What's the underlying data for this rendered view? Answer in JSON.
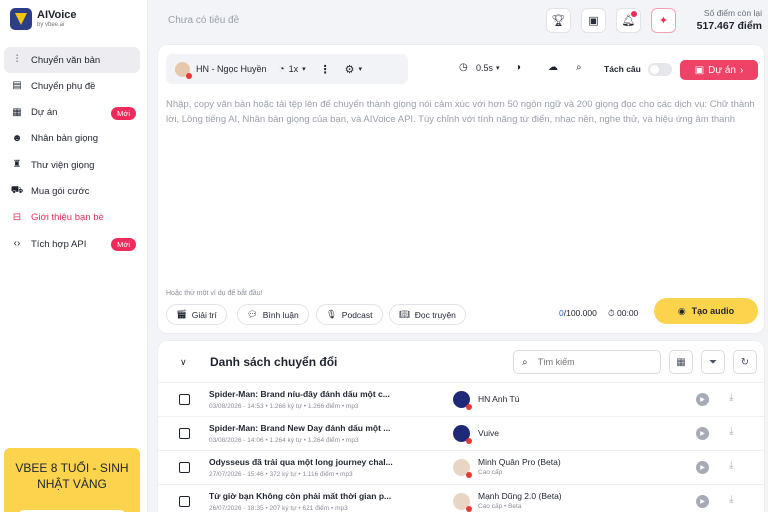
{
  "brand": {
    "name": "AIVoice",
    "by": "by vbee.ai"
  },
  "sidebar": {
    "items": [
      {
        "label": "Chuyển văn bản",
        "icon": "waveform-icon",
        "glyph": "⫶",
        "active": true,
        "new": false,
        "red": false
      },
      {
        "label": "Chuyển phụ đề",
        "icon": "subtitle-icon",
        "glyph": "▤",
        "active": false,
        "new": false,
        "red": false
      },
      {
        "label": "Dự án",
        "icon": "clapperboard-icon",
        "glyph": "▦",
        "active": false,
        "new": true,
        "red": false
      },
      {
        "label": "Nhân bản giọng",
        "icon": "voice-clone-icon",
        "glyph": "☻",
        "active": false,
        "new": false,
        "red": false
      },
      {
        "label": "Thư viện giọng",
        "icon": "voice-library-icon",
        "glyph": "♜",
        "active": false,
        "new": false,
        "red": false
      },
      {
        "label": "Mua gói cước",
        "icon": "cart-icon",
        "glyph": "⛟",
        "active": false,
        "new": false,
        "red": false
      },
      {
        "label": "Giới thiệu bạn bè",
        "icon": "gift-icon",
        "glyph": "⊟",
        "active": false,
        "new": false,
        "red": true
      },
      {
        "label": "Tích hợp API",
        "icon": "code-icon",
        "glyph": "‹›",
        "active": false,
        "new": true,
        "red": false
      }
    ],
    "new_label": "Mới",
    "promo": "VBEE 8 TUỔI - SINH NHẬT VÀNG"
  },
  "header": {
    "doc_title": "Chưa có tiêu đề",
    "points_label": "Số điểm còn lại",
    "points_value": "517.467 điểm"
  },
  "editor": {
    "voice_name": "HN - Ngọc Huyền",
    "speed": "1x",
    "pause": "0.5s",
    "split_label": "Tách câu",
    "project_label": "Dự án",
    "placeholder": "Nhập, copy văn bản hoặc tải tệp lên để chuyển thành giọng nói cảm xúc với hơn 50 ngôn ngữ và 200 giọng đọc cho các dịch vụ: Chữ thành lời, Lồng tiếng AI, Nhân bản giọng của bạn, và AIVoice API. Tùy chỉnh với tính năng từ điển, nhạc nền, nghe thử, và hiệu ứng âm thanh",
    "hint": "Hoặc thử một ví dụ để bắt đầu!",
    "chips": [
      "Giải trí",
      "Bình luận",
      "Podcast",
      "Đọc truyện"
    ],
    "char_count": "0",
    "char_limit": "/100.000",
    "duration": "00:00",
    "create_label": "Tạo audio"
  },
  "list": {
    "title": "Danh sách chuyển đổi",
    "search_placeholder": "Tìm kiếm",
    "rows": [
      {
        "title": "Spider-Man: Brand níu-đây đánh dấu một c...",
        "meta": "03/08/2026 - 14:53 • 1.266 ký tự • 1.266 điểm • mp3",
        "voice": "HN Anh Tú",
        "tier": ""
      },
      {
        "title": "Spider-Man: Brand New Day đánh dấu một ...",
        "meta": "03/08/2026 - 14:06 • 1.264 ký tự • 1.264 điểm • mp3",
        "voice": "Vuive",
        "tier": ""
      },
      {
        "title": "Odysseus đã trải qua một long journey chal...",
        "meta": "27/07/2026 - 15:46 • 372 ký tự • 1.116 điểm • mp3",
        "voice": "Minh Quân Pro (Beta)",
        "tier": "Cao cấp"
      },
      {
        "title": "Từ giờ bạn Không còn phải mất thời gian p...",
        "meta": "26/07/2026 - 18:35 • 207 ký tự • 621 điểm • mp3",
        "voice": "Mạnh Dũng 2.0 (Beta)",
        "tier": "Cao cấp • Beta"
      }
    ]
  }
}
